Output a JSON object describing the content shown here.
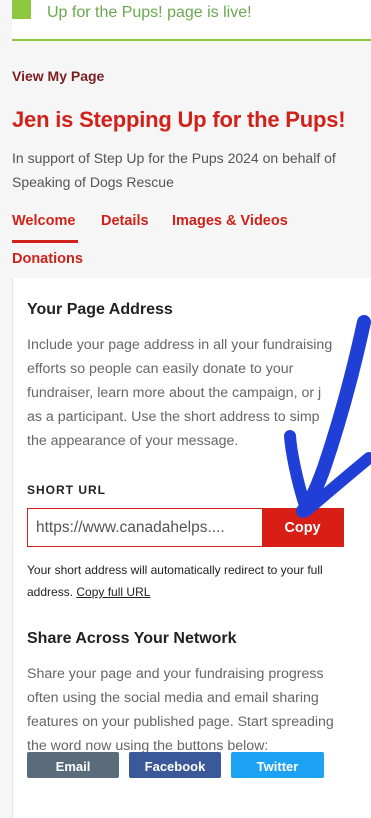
{
  "banner": {
    "text": "Up for the Pups! page is live!"
  },
  "nav": {
    "view_my_page": "View My Page"
  },
  "page": {
    "title": "Jen is Stepping Up for the Pups!",
    "subtitle": "In support of Step Up for the Pups 2024 on behalf of Speaking of Dogs Rescue"
  },
  "tabs": [
    {
      "label": "Welcome",
      "active": true
    },
    {
      "label": "Details",
      "active": false
    },
    {
      "label": "Images & Videos",
      "active": false
    },
    {
      "label": "Donations",
      "active": false
    }
  ],
  "page_address": {
    "title": "Your Page Address",
    "lines": [
      "Include your page address in all your fundraising",
      "efforts so people can easily donate to your",
      "fundraiser, learn more about the campaign, or j",
      "as a participant. Use the short address to simp",
      "the appearance of your message."
    ],
    "short_url_label": "SHORT URL",
    "short_url_value": "https://www.canadahelps....",
    "copy_label": "Copy",
    "redirect_note": "Your short address will automatically redirect to your full address.",
    "copy_full_url_link": "Copy full URL"
  },
  "share": {
    "title": "Share Across Your Network",
    "lines": [
      "Share your page and your fundraising progress",
      "often using the social media and email sharing",
      "features on your published page. Start spreading",
      "the word now using the buttons below:"
    ],
    "buttons": [
      {
        "label": "Email",
        "color": "#5a6b7b"
      },
      {
        "label": "Facebook",
        "color": "#3b5998"
      },
      {
        "label": "Twitter",
        "color": "#1da1f2"
      }
    ]
  },
  "colors": {
    "accent": "#d0221a",
    "banner_green": "#8dc63f",
    "annotation_blue": "#1f3fd6"
  }
}
